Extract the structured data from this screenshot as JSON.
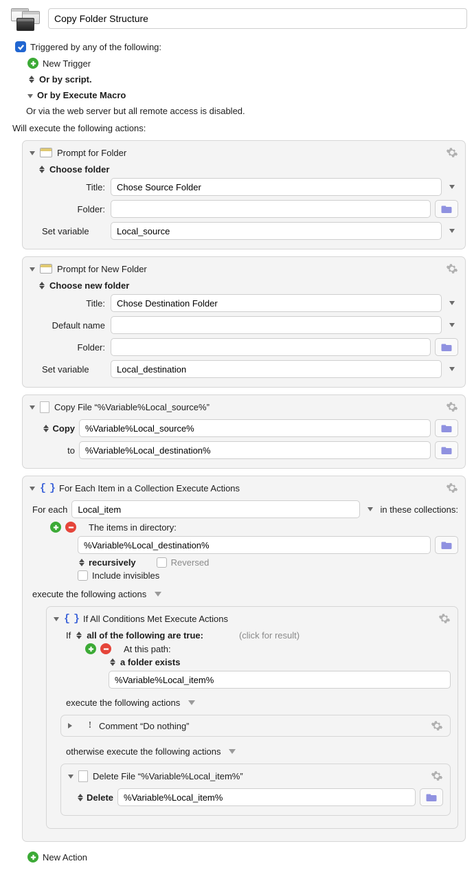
{
  "macro_name": "Copy Folder Structure",
  "triggers": {
    "triggered_by_label": "Triggered by any of the following:",
    "new_trigger_label": "New Trigger",
    "or_by_script_label": "Or by script.",
    "or_by_execute_macro_label": "Or by Execute Macro",
    "or_via_web_label": "Or via the web server but all remote access is disabled."
  },
  "will_execute_label": "Will execute the following actions:",
  "a1": {
    "title": "Prompt for Folder",
    "choose_label": "Choose folder",
    "title_label": "Title:",
    "title_value": "Chose Source Folder",
    "folder_label": "Folder:",
    "folder_value": "",
    "setvar_label": "Set variable",
    "setvar_value": "Local_source"
  },
  "a2": {
    "title": "Prompt for New Folder",
    "choose_label": "Choose new folder",
    "title_label": "Title:",
    "title_value": "Chose Destination Folder",
    "default_name_label": "Default name",
    "default_name_value": "",
    "folder_label": "Folder:",
    "folder_value": "",
    "setvar_label": "Set variable",
    "setvar_value": "Local_destination"
  },
  "a3": {
    "title": "Copy File “%Variable%Local_source%”",
    "copy_label": "Copy",
    "copy_value": "%Variable%Local_source%",
    "to_label": "to",
    "to_value": "%Variable%Local_destination%"
  },
  "a4": {
    "title": "For Each Item in a Collection Execute Actions",
    "for_each_label": "For each",
    "var_value": "Local_item",
    "in_collections_label": "in these collections:",
    "items_in_dir_label": "The items in directory:",
    "dir_value": "%Variable%Local_destination%",
    "recursively_label": "recursively",
    "reversed_label": "Reversed",
    "include_invisibles_label": "Include invisibles",
    "execute_label": "execute the following actions"
  },
  "a5": {
    "title": "If All Conditions Met Execute Actions",
    "if_label": "If",
    "all_true_label": "all of the following are true:",
    "click_result_label": "(click for result)",
    "at_path_label": "At this path:",
    "folder_exists_label": "a folder exists",
    "path_value": "%Variable%Local_item%",
    "execute_label": "execute the following actions",
    "otherwise_label": "otherwise execute the following actions"
  },
  "a6": {
    "title": "Comment “Do nothing”"
  },
  "a7": {
    "title": "Delete File “%Variable%Local_item%”",
    "delete_label": "Delete",
    "delete_value": "%Variable%Local_item%"
  },
  "new_action_label": "New Action"
}
